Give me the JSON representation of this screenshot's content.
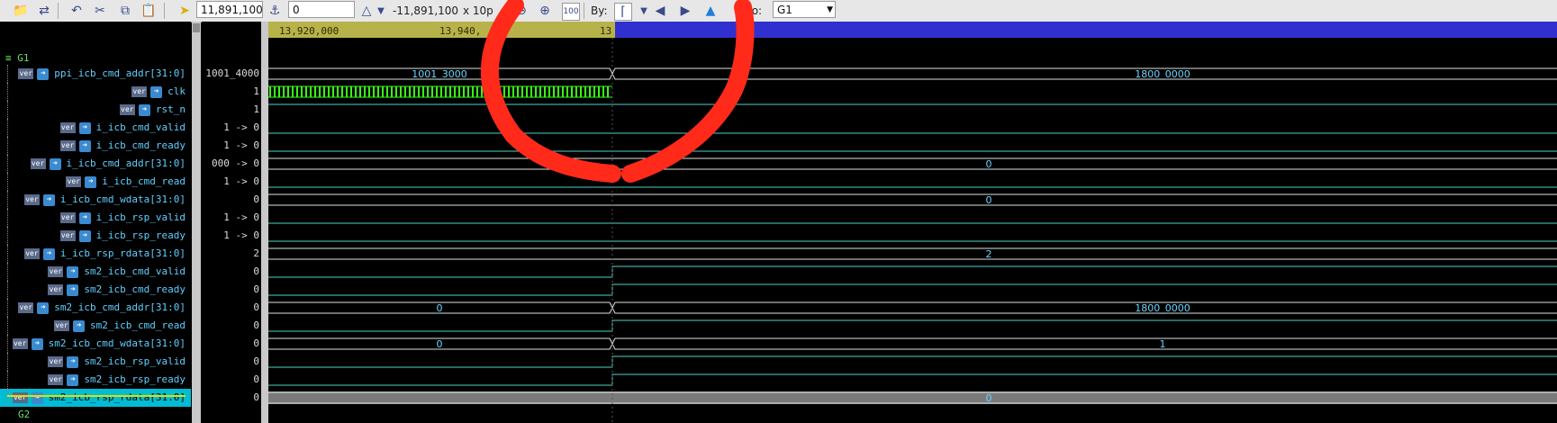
{
  "toolbar": {
    "time_field": "11,891,100",
    "delta_field": "0",
    "delta_text": "-11,891,100",
    "zoom_text": "x 10p",
    "by_label": "By:",
    "to_label": "to:",
    "to_select": "G1"
  },
  "ruler": {
    "ticks": [
      "13,920,000",
      "13,940,",
      "13"
    ]
  },
  "groups": {
    "g1": "G1",
    "g2": "G2"
  },
  "tag": "ver",
  "signals": [
    {
      "name": "ppi_icb_cmd_addr[31:0]",
      "value": "1001_4000",
      "wave_labels": [
        "1001_3000",
        "1800_0000"
      ]
    },
    {
      "name": "clk",
      "value": "1"
    },
    {
      "name": "rst_n",
      "value": "1"
    },
    {
      "name": "i_icb_cmd_valid",
      "value": "1 -> 0"
    },
    {
      "name": "i_icb_cmd_ready",
      "value": "1 -> 0"
    },
    {
      "name": "i_icb_cmd_addr[31:0]",
      "value": "000 -> 0",
      "wave_labels": [
        "0"
      ]
    },
    {
      "name": "i_icb_cmd_read",
      "value": "1 -> 0"
    },
    {
      "name": "i_icb_cmd_wdata[31:0]",
      "value": "0",
      "wave_labels": [
        "0"
      ]
    },
    {
      "name": "i_icb_rsp_valid",
      "value": "1 -> 0"
    },
    {
      "name": "i_icb_rsp_ready",
      "value": "1 -> 0"
    },
    {
      "name": "i_icb_rsp_rdata[31:0]",
      "value": "2",
      "wave_labels": [
        "2"
      ]
    },
    {
      "name": "sm2_icb_cmd_valid",
      "value": "0"
    },
    {
      "name": "sm2_icb_cmd_ready",
      "value": "0"
    },
    {
      "name": "sm2_icb_cmd_addr[31:0]",
      "value": "0",
      "wave_labels": [
        "0",
        "1800_0000"
      ]
    },
    {
      "name": "sm2_icb_cmd_read",
      "value": "0"
    },
    {
      "name": "sm2_icb_cmd_wdata[31:0]",
      "value": "0",
      "wave_labels": [
        "0",
        "1"
      ]
    },
    {
      "name": "sm2_icb_rsp_valid",
      "value": "0"
    },
    {
      "name": "sm2_icb_rsp_ready",
      "value": "0"
    },
    {
      "name": "sm2_icb_rsp_rdata[31:0]",
      "value": "0",
      "wave_labels": [
        "0"
      ]
    }
  ],
  "colors": {
    "wave": "#4fd1c5",
    "bus": "#e0e0e0",
    "clk": "#39ff14",
    "selected": "#00bcd4",
    "annotation": "#ff2a1a"
  }
}
